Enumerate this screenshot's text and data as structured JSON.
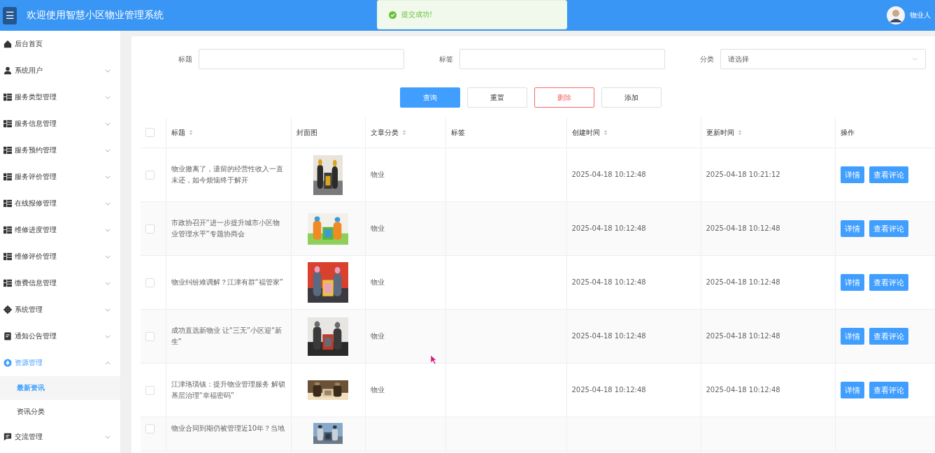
{
  "header": {
    "menu_glyph": "☰",
    "title": "欢迎使用智慧小区物业管理系统",
    "user": "物业人"
  },
  "toast": {
    "text": "提交成功!"
  },
  "sidebar": {
    "items": [
      {
        "label": "后台首页",
        "kind": "home",
        "expanded": false,
        "has_arrow": false
      },
      {
        "label": "系统用户",
        "kind": "user",
        "expanded": false,
        "has_arrow": true
      },
      {
        "label": "服务类型管理",
        "kind": "grid",
        "expanded": false,
        "has_arrow": true
      },
      {
        "label": "服务信息管理",
        "kind": "grid",
        "expanded": false,
        "has_arrow": true
      },
      {
        "label": "服务预约管理",
        "kind": "grid",
        "expanded": false,
        "has_arrow": true
      },
      {
        "label": "服务评价管理",
        "kind": "grid",
        "expanded": false,
        "has_arrow": true
      },
      {
        "label": "在线报修管理",
        "kind": "grid",
        "expanded": false,
        "has_arrow": true
      },
      {
        "label": "维修进度管理",
        "kind": "grid",
        "expanded": false,
        "has_arrow": true
      },
      {
        "label": "维修评价管理",
        "kind": "grid",
        "expanded": false,
        "has_arrow": true
      },
      {
        "label": "缴费信息管理",
        "kind": "grid",
        "expanded": false,
        "has_arrow": true
      },
      {
        "label": "系统管理",
        "kind": "gear",
        "expanded": false,
        "has_arrow": true
      },
      {
        "label": "通知公告管理",
        "kind": "doc",
        "expanded": false,
        "has_arrow": true
      },
      {
        "label": "资源管理",
        "kind": "compass",
        "expanded": true,
        "has_arrow": true,
        "children": [
          {
            "label": "最新资讯",
            "selected": true
          },
          {
            "label": "资讯分类",
            "selected": false
          }
        ]
      },
      {
        "label": "交流管理",
        "kind": "chat",
        "expanded": false,
        "has_arrow": true
      }
    ]
  },
  "filters": [
    {
      "label": "标题",
      "kind": "input"
    },
    {
      "label": "标签",
      "kind": "input"
    },
    {
      "label": "分类",
      "kind": "select",
      "placeholder": "请选择"
    }
  ],
  "buttons": [
    {
      "label": "查询",
      "kind": "primary"
    },
    {
      "label": "重置",
      "kind": "plain"
    },
    {
      "label": "删除",
      "kind": "danger"
    },
    {
      "label": "添加",
      "kind": "plain"
    }
  ],
  "table": {
    "columns": [
      {
        "label": "标题",
        "sortable": true
      },
      {
        "label": "封面图",
        "sortable": false
      },
      {
        "label": "文章分类",
        "sortable": true
      },
      {
        "label": "标签",
        "sortable": false
      },
      {
        "label": "创建时间",
        "sortable": true
      },
      {
        "label": "更新时间",
        "sortable": true
      },
      {
        "label": "操作",
        "sortable": false
      }
    ],
    "header_checked": false,
    "rows": [
      {
        "checked": false,
        "title": "物业撤离了，遗留的经营性收入一直未还，如今烦恼终于解开",
        "cover": {
          "kind": "picture"
        },
        "category": "物业",
        "created": "2025-04-18 10:12:48",
        "updated": "2025-04-18 10:21:12",
        "actions": [
          "详情",
          "查看评论"
        ]
      },
      {
        "checked": false,
        "title": "市政协召开“进一步提升城市小区物业管理水平”专题协商会",
        "cover": {
          "kind": "picture"
        },
        "category": "物业",
        "created": "2025-04-18 10:12:48",
        "updated": "2025-04-18 10:12:48",
        "actions": [
          "详情",
          "查看评论"
        ]
      },
      {
        "checked": false,
        "title": "物业纠纷难调解？江津有群“福管家”",
        "cover": {
          "kind": "picture"
        },
        "category": "物业",
        "created": "2025-04-18 10:12:48",
        "updated": "2025-04-18 10:12:48",
        "actions": [
          "详情",
          "查看评论"
        ]
      },
      {
        "checked": false,
        "title": "成功直选新物业 让“三无”小区迎“新生”",
        "cover": {
          "kind": "picture"
        },
        "category": "物业",
        "created": "2025-04-18 10:12:48",
        "updated": "2025-04-18 10:12:48",
        "actions": [
          "详情",
          "查看评论"
        ]
      },
      {
        "checked": false,
        "title": "江津珞璜镇：提升物业管理服务 解锁基层治理“幸福密码”",
        "cover": {
          "kind": "picture"
        },
        "category": "物业",
        "created": "2025-04-18 10:12:48",
        "updated": "2025-04-18 10:12:48",
        "actions": [
          "详情",
          "查看评论"
        ]
      },
      {
        "checked": false,
        "title": "物业合同到期仍被管理近10年？当地",
        "cover": {
          "kind": "picture"
        }
      }
    ]
  }
}
